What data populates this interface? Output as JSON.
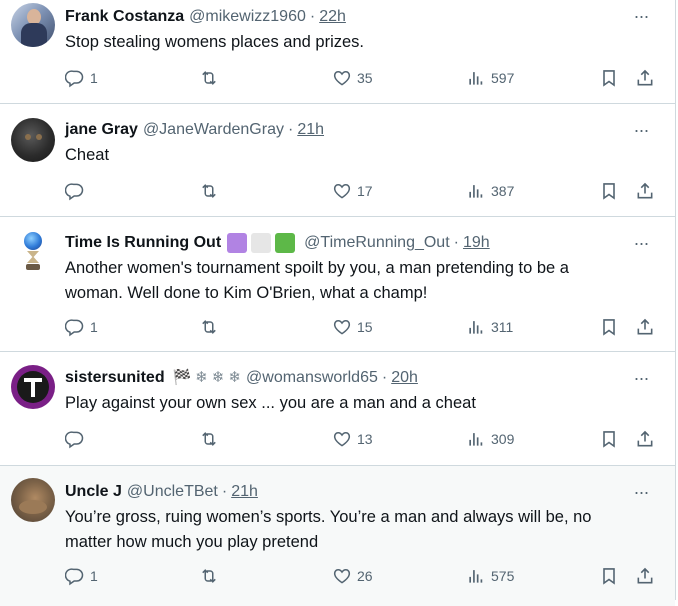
{
  "tweets": [
    {
      "name": "Frank Costanza",
      "handle": "@mikewizz1960",
      "sep": "·",
      "time": "22h",
      "text": "Stop stealing womens  places  and prizes.",
      "replies": "1",
      "retweets": "",
      "likes": "35",
      "views": "597"
    },
    {
      "name": "jane Gray",
      "handle": "@JaneWardenGray",
      "sep": "·",
      "time": "21h",
      "text": "Cheat",
      "replies": "",
      "retweets": "",
      "likes": "17",
      "views": "387"
    },
    {
      "name": "Time Is Running Out",
      "handle": "@TimeRunning_Out",
      "sep": "·",
      "time": "19h",
      "text": "Another women's tournament spoilt by you, a man pretending to be a woman. Well done to Kim O'Brien, what a champ!",
      "replies": "1",
      "retweets": "",
      "likes": "15",
      "views": "311",
      "badge_colors": [
        "#b183e3",
        "#e6e6e6",
        "#5db848"
      ]
    },
    {
      "name": "sistersunited",
      "handle": "@womansworld65",
      "sep": "·",
      "time": "20h",
      "text": "Play against your own sex ... you are a man and a cheat",
      "replies": "",
      "retweets": "",
      "likes": "13",
      "views": "309",
      "emoji": [
        "🏁",
        "❄",
        "❄",
        "❄"
      ]
    },
    {
      "name": "Uncle J",
      "handle": "@UncleTBet",
      "sep": "·",
      "time": "21h",
      "text": "You’re gross, ruing women’s sports. You’re a man and always will be, no matter how much you play pretend",
      "replies": "1",
      "retweets": "",
      "likes": "26",
      "views": "575"
    }
  ],
  "more_glyph": "···",
  "colors": {
    "text": "#0f1419",
    "secondary": "#536471",
    "divider": "#cfd9de",
    "highlight_bg": "#f7f9f9"
  }
}
